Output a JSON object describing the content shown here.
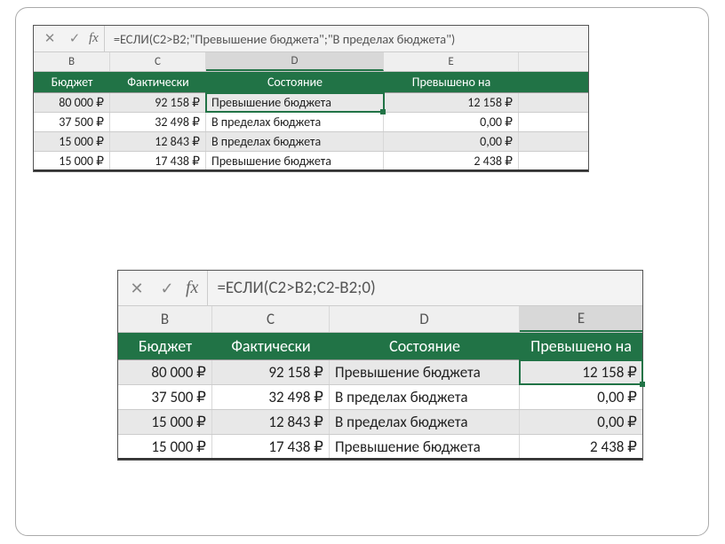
{
  "columns": {
    "B": "B",
    "C": "C",
    "D": "D",
    "E": "E"
  },
  "headers": {
    "budget": "Бюджет",
    "actual": "Фактически",
    "status": "Состояние",
    "over": "Превышено на"
  },
  "fx_label": "fx",
  "cancel_glyph": "✕",
  "accept_glyph": "✓",
  "shot1": {
    "formula": "=ЕСЛИ(C2>B2;\"Превышение бюджета\";\"В пределах бюджета\")",
    "selected_col": "D",
    "rows": [
      {
        "b": "80 000 ₽",
        "c": "92 158 ₽",
        "d": "Превышение бюджета",
        "e": "12 158 ₽",
        "band": true,
        "sel": true
      },
      {
        "b": "37 500 ₽",
        "c": "32 498 ₽",
        "d": "В пределах бюджета",
        "e": "0,00 ₽",
        "band": false,
        "sel": false
      },
      {
        "b": "15 000 ₽",
        "c": "12 843 ₽",
        "d": "В пределах бюджета",
        "e": "0,00 ₽",
        "band": true,
        "sel": false
      },
      {
        "b": "15 000 ₽",
        "c": "17 438 ₽",
        "d": "Превышение бюджета",
        "e": "2 438 ₽",
        "band": false,
        "sel": false
      }
    ]
  },
  "shot2": {
    "formula": "=ЕСЛИ(C2>B2;C2-B2;0)",
    "selected_col": "E",
    "rows": [
      {
        "b": "80 000 ₽",
        "c": "92 158 ₽",
        "d": "Превышение бюджета",
        "e": "12 158 ₽",
        "band": true,
        "sel": true
      },
      {
        "b": "37 500 ₽",
        "c": "32 498 ₽",
        "d": "В пределах бюджета",
        "e": "0,00 ₽",
        "band": false,
        "sel": false
      },
      {
        "b": "15 000 ₽",
        "c": "12 843 ₽",
        "d": "В пределах бюджета",
        "e": "0,00 ₽",
        "band": true,
        "sel": false
      },
      {
        "b": "15 000 ₽",
        "c": "17 438 ₽",
        "d": "Превышение бюджета",
        "e": "2 438 ₽",
        "band": false,
        "sel": false
      }
    ]
  }
}
